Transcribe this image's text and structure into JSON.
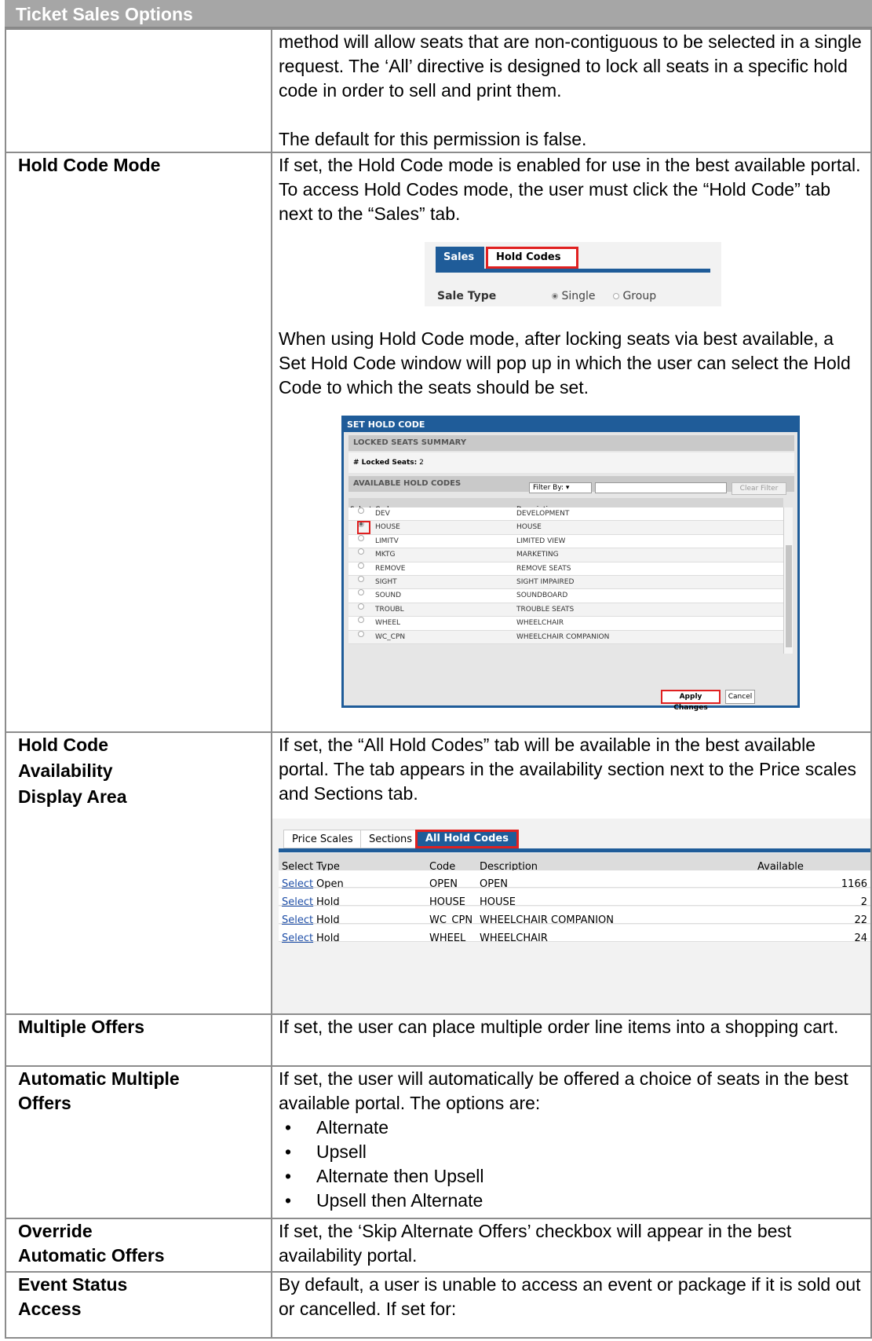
{
  "title": "Ticket Sales Options",
  "rows": {
    "r0": {
      "label": "",
      "p1": "method will allow seats that are non-contiguous to be selected in a single request.  The ‘All’ directive is designed to lock all seats in a specific hold code in order to sell and print them.",
      "p2": "The default for this permission is false."
    },
    "r1": {
      "label": "Hold Code Mode",
      "p1": "If set, the Hold Code mode is enabled for use in the best available portal.  To access Hold Codes mode, the user must click the “Hold Code” tab next to the “Sales” tab.",
      "p2": "When using Hold Code mode, after locking seats via best available, a Set Hold Code window will pop up in which the user can select the Hold Code to which the seats should be set."
    },
    "r2": {
      "label1": "Hold Code",
      "label2": "Availability",
      "label3": "Display Area",
      "p1": "If set, the “All Hold Codes” tab will be available in the best available portal. The tab appears in the availability section next to the Price scales and Sections tab."
    },
    "r3": {
      "label": "Multiple Offers",
      "p1": "If set, the user can place multiple order line items into a shopping cart."
    },
    "r4": {
      "label1": "Automatic Multiple",
      "label2": "Offers",
      "p1": "If set, the user will automatically be offered a choice of seats in the best available portal.  The options are:",
      "bullets": [
        "Alternate",
        "Upsell",
        "Alternate then Upsell",
        "Upsell then Alternate"
      ]
    },
    "r5": {
      "label1": "Override",
      "label2": "Automatic Offers",
      "p1": "If set, the ‘Skip Alternate Offers’ checkbox will appear in the best availability portal."
    },
    "r6": {
      "label1": "Event Status",
      "label2": "Access",
      "p1": "By default, a user is unable to access an event or package if it is sold out or cancelled. If set for:"
    }
  },
  "sales_ui": {
    "tab_sales": "Sales",
    "tab_hold_codes": "Hold Codes",
    "sale_type_label": "Sale Type",
    "opt_single": "Single",
    "opt_group": "Group"
  },
  "set_hold_code": {
    "title": "SET HOLD CODE",
    "locked_summary": "LOCKED SEATS SUMMARY",
    "locked_seats_label": "# Locked Seats:",
    "locked_seats_value": "2",
    "available_hold_codes": "AVAILABLE HOLD CODES",
    "filter_by": "Filter By:",
    "clear_filter": "Clear Filter",
    "col_select": "Select",
    "col_code": "Code",
    "col_description": "Description",
    "rows": [
      {
        "code": "DEV",
        "desc": "DEVELOPMENT"
      },
      {
        "code": "HOUSE",
        "desc": "HOUSE"
      },
      {
        "code": "LIMITV",
        "desc": "LIMITED VIEW"
      },
      {
        "code": "MKTG",
        "desc": "MARKETING"
      },
      {
        "code": "REMOVE",
        "desc": "REMOVE SEATS"
      },
      {
        "code": "SIGHT",
        "desc": "SIGHT IMPAIRED"
      },
      {
        "code": "SOUND",
        "desc": "SOUNDBOARD"
      },
      {
        "code": "TROUBL",
        "desc": "TROUBLE SEATS"
      },
      {
        "code": "WHEEL",
        "desc": "WHEELCHAIR"
      },
      {
        "code": "WC_CPN",
        "desc": "WHEELCHAIR COMPANION"
      }
    ],
    "apply": "Apply Changes",
    "cancel": "Cancel"
  },
  "availability": {
    "tab_price_scales": "Price Scales",
    "tab_sections": "Sections",
    "tab_all_hold_codes": "All Hold Codes",
    "col_select": "Select",
    "col_type": "Type",
    "col_code": "Code",
    "col_description": "Description",
    "col_available": "Available",
    "rows": [
      {
        "select": "Select",
        "type": "Open",
        "code": "OPEN",
        "desc": "OPEN",
        "avail": "1166"
      },
      {
        "select": "Select",
        "type": "Hold",
        "code": "HOUSE",
        "desc": "HOUSE",
        "avail": "2"
      },
      {
        "select": "Select",
        "type": "Hold",
        "code": "WC_CPN",
        "desc": "WHEELCHAIR COMPANION",
        "avail": "22"
      },
      {
        "select": "Select",
        "type": "Hold",
        "code": "WHEEL",
        "desc": "WHEELCHAIR",
        "avail": "24"
      }
    ]
  }
}
